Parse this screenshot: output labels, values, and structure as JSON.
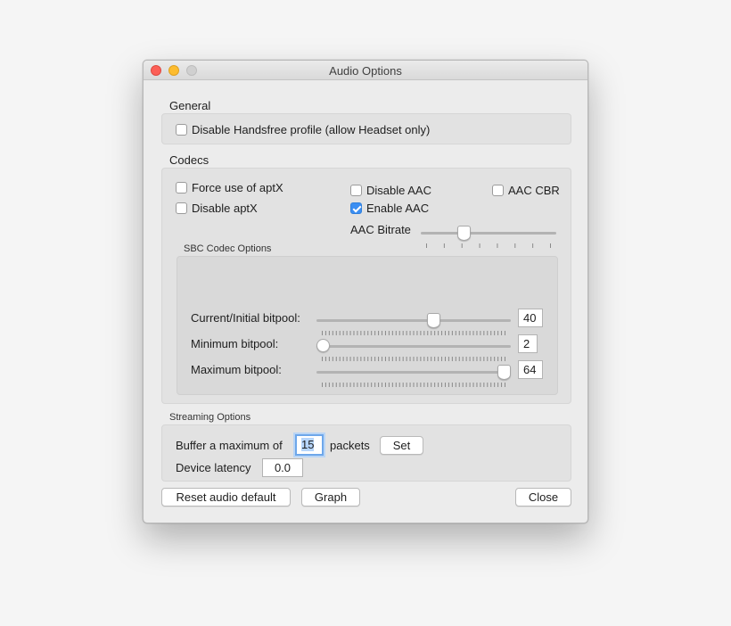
{
  "window": {
    "title": "Audio Options"
  },
  "general": {
    "label": "General",
    "disable_handsfree": {
      "label": "Disable Handsfree profile (allow Headset only)",
      "checked": false
    }
  },
  "codecs": {
    "label": "Codecs",
    "force_aptx": {
      "label": "Force use of aptX",
      "checked": false
    },
    "disable_aptx": {
      "label": "Disable aptX",
      "checked": false
    },
    "disable_aac": {
      "label": "Disable AAC",
      "checked": false
    },
    "enable_aac": {
      "label": "Enable AAC",
      "checked": true
    },
    "aac_cbr": {
      "label": "AAC CBR",
      "checked": false
    },
    "aac_bitrate": {
      "label": "AAC Bitrate",
      "level": 0.3
    }
  },
  "sbc": {
    "label": "SBC Codec Options",
    "current": {
      "label": "Current/Initial bitpool:",
      "value": "40",
      "level": 0.61
    },
    "minimum": {
      "label": "Minimum bitpool:",
      "value": "2",
      "level": 0.0
    },
    "maximum": {
      "label": "Maximum bitpool:",
      "value": "64",
      "level": 1.0
    }
  },
  "streaming": {
    "label": "Streaming Options",
    "buffer_prefix": "Buffer a maximum of",
    "buffer_value": "15",
    "buffer_suffix": "packets",
    "set_label": "Set",
    "latency_label": "Device latency",
    "latency_value": "0.0"
  },
  "footer": {
    "reset_label": "Reset audio default",
    "graph_label": "Graph",
    "close_label": "Close"
  },
  "colors": {
    "accent": "#3b8ef2",
    "close": "#fc5f57",
    "minimize": "#fdbc2e"
  }
}
